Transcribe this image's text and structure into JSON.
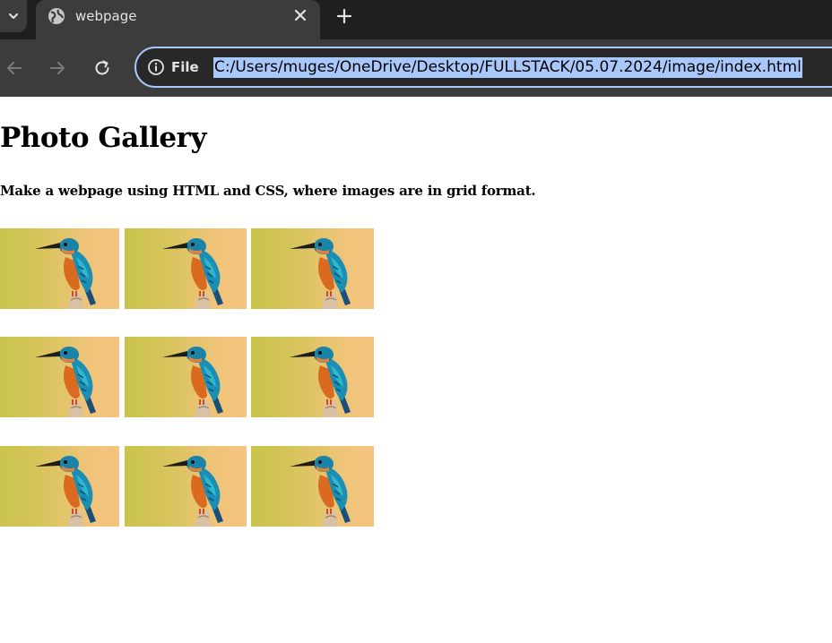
{
  "browser": {
    "tab_title": "webpage",
    "site_info_label": "File",
    "url": "C:/Users/muges/OneDrive/Desktop/FULLSTACK/05.07.2024/image/index.html",
    "icons": {
      "tab_search": "chevron-down-icon",
      "favicon": "globe-icon",
      "close": "close-icon",
      "new_tab": "plus-icon",
      "back": "arrow-left-icon",
      "forward": "arrow-right-icon",
      "reload": "reload-icon",
      "info": "info-icon"
    },
    "colors": {
      "tabstrip": "#1f1f1f",
      "toolbar": "#3c3c3c",
      "url_highlight": "#a8c7fa"
    }
  },
  "page": {
    "heading": "Photo Gallery",
    "description": "Make a webpage using HTML and CSS, where images are in grid format.",
    "gallery": {
      "rows": 3,
      "columns": 3,
      "image_subject": "kingfisher-bird-photo"
    }
  }
}
